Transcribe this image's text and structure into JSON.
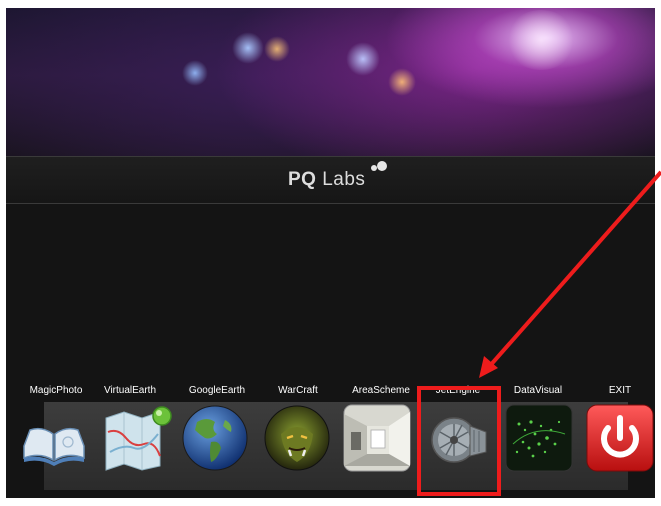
{
  "brand": {
    "name_bold": "PQ",
    "name_light": "Labs"
  },
  "apps": [
    {
      "label": "MagicPhoto",
      "icon": "book-icon"
    },
    {
      "label": "VirtualEarth",
      "icon": "map-icon"
    },
    {
      "label": "GoogleEarth",
      "icon": "globe-icon"
    },
    {
      "label": "WarCraft",
      "icon": "orc-face-icon"
    },
    {
      "label": "AreaScheme",
      "icon": "room-icon"
    },
    {
      "label": "JetEngine",
      "icon": "jet-engine-icon"
    },
    {
      "label": "DataVisual",
      "icon": "data-visual-icon"
    },
    {
      "label": "EXIT",
      "icon": "power-icon"
    }
  ],
  "colors": {
    "highlight": "#ee1c1c",
    "exit": "#e02020",
    "background": "#141414"
  }
}
